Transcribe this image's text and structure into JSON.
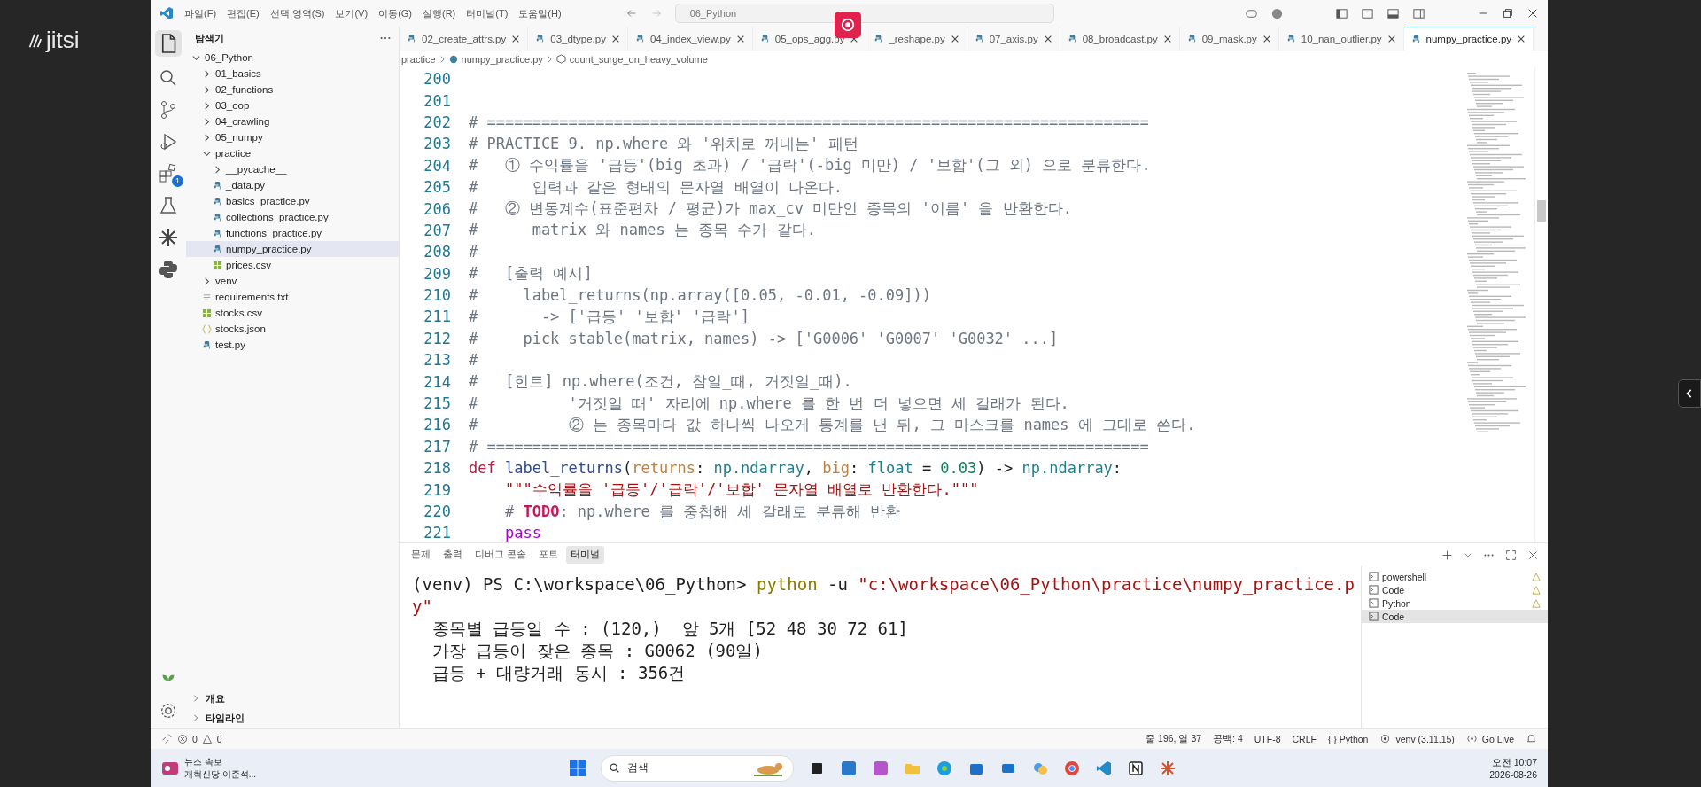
{
  "meeting": {
    "logo": "jitsi"
  },
  "titlebar": {
    "menu": [
      "파일(F)",
      "편집(E)",
      "선택 영역(S)",
      "보기(V)",
      "이동(G)",
      "실행(R)",
      "터미널(T)",
      "도움말(H)"
    ],
    "search": "06_Python"
  },
  "activity_bar": {
    "extensions_badge": "1"
  },
  "explorer": {
    "title": "탐색기",
    "tree": [
      {
        "label": "06_Python",
        "kind": "folder",
        "expanded": true,
        "children": [
          {
            "label": "01_basics",
            "kind": "folder",
            "expanded": false
          },
          {
            "label": "02_functions",
            "kind": "folder",
            "expanded": false
          },
          {
            "label": "03_oop",
            "kind": "folder",
            "expanded": false
          },
          {
            "label": "04_crawling",
            "kind": "folder",
            "expanded": false
          },
          {
            "label": "05_numpy",
            "kind": "folder",
            "expanded": false
          },
          {
            "label": "practice",
            "kind": "folder",
            "expanded": true,
            "children": [
              {
                "label": "__pycache__",
                "kind": "folder",
                "expanded": false
              },
              {
                "label": "_data.py",
                "kind": "python",
                "selected": false
              },
              {
                "label": "basics_practice.py",
                "kind": "python",
                "selected": false
              },
              {
                "label": "collections_practice.py",
                "kind": "python",
                "selected": false
              },
              {
                "label": "functions_practice.py",
                "kind": "python",
                "selected": false
              },
              {
                "label": "numpy_practice.py",
                "kind": "python",
                "selected": true
              },
              {
                "label": "prices.csv",
                "kind": "csv",
                "selected": false
              }
            ]
          },
          {
            "label": "venv",
            "kind": "folder",
            "expanded": false
          },
          {
            "label": "requirements.txt",
            "kind": "text",
            "selected": false
          },
          {
            "label": "stocks.csv",
            "kind": "csv",
            "selected": false
          },
          {
            "label": "stocks.json",
            "kind": "json",
            "selected": false
          },
          {
            "label": "test.py",
            "kind": "python",
            "selected": false
          }
        ]
      }
    ],
    "sections": [
      "개요",
      "타임라인"
    ]
  },
  "tabs": [
    {
      "label": "02_create_attrs.py",
      "selected": false
    },
    {
      "label": "03_dtype.py",
      "selected": false
    },
    {
      "label": "04_index_view.py",
      "selected": false
    },
    {
      "label": "05_ops_agg.py",
      "selected": false
    },
    {
      "label": "_reshape.py",
      "selected": false
    },
    {
      "label": "07_axis.py",
      "selected": false
    },
    {
      "label": "08_broadcast.py",
      "selected": false
    },
    {
      "label": "09_mask.py",
      "selected": false
    },
    {
      "label": "10_nan_outlier.py",
      "selected": false
    },
    {
      "label": "numpy_practice.py",
      "selected": true
    }
  ],
  "breadcrumb": [
    "practice",
    "numpy_practice.py",
    "count_surge_on_heavy_volume"
  ],
  "editor": {
    "lines": [
      {
        "number": "200"
      },
      {
        "number": "201"
      },
      {
        "number": "202",
        "tokens": [
          {
            "kind": "comment",
            "text": "# ========================================================================="
          }
        ]
      },
      {
        "number": "203",
        "tokens": [
          {
            "kind": "comment",
            "text": "# PRACTICE 9. np.where 와 '위치로 꺼내는' 패턴"
          }
        ]
      },
      {
        "number": "204",
        "tokens": [
          {
            "kind": "comment",
            "text": "#   ① 수익률을 '급등'(big 초과) / '급락'(-big 미만) / '보합'(그 외) 으로 분류한다."
          }
        ]
      },
      {
        "number": "205",
        "tokens": [
          {
            "kind": "comment",
            "text": "#      입력과 같은 형태의 문자열 배열이 나온다."
          }
        ]
      },
      {
        "number": "206",
        "tokens": [
          {
            "kind": "comment",
            "text": "#   ② 변동계수(표준편차 / 평균)가 max_cv 미만인 종목의 '이름' 을 반환한다."
          }
        ]
      },
      {
        "number": "207",
        "tokens": [
          {
            "kind": "comment",
            "text": "#      matrix 와 names 는 종목 수가 같다."
          }
        ]
      },
      {
        "number": "208",
        "tokens": [
          {
            "kind": "comment",
            "text": "#"
          }
        ]
      },
      {
        "number": "209",
        "tokens": [
          {
            "kind": "comment",
            "text": "#   [출력 예시]"
          }
        ]
      },
      {
        "number": "210",
        "tokens": [
          {
            "kind": "comment",
            "text": "#     label_returns(np.array([0.05, -0.01, -0.09]))"
          }
        ]
      },
      {
        "number": "211",
        "tokens": [
          {
            "kind": "comment",
            "text": "#       -> ['급등' '보합' '급락']"
          }
        ]
      },
      {
        "number": "212",
        "tokens": [
          {
            "kind": "comment",
            "text": "#     pick_stable(matrix, names) -> ['G0006' 'G0007' 'G0032' ...]"
          }
        ]
      },
      {
        "number": "213",
        "tokens": [
          {
            "kind": "comment",
            "text": "#"
          }
        ]
      },
      {
        "number": "214",
        "tokens": [
          {
            "kind": "comment",
            "text": "#   [힌트] np.where(조건, 참일_때, 거짓일_때)."
          }
        ]
      },
      {
        "number": "215",
        "tokens": [
          {
            "kind": "comment",
            "text": "#          '거짓일 때' 자리에 np.where 를 한 번 더 넣으면 세 갈래가 된다."
          }
        ]
      },
      {
        "number": "216",
        "tokens": [
          {
            "kind": "comment",
            "text": "#          ② 는 종목마다 값 하나씩 나오게 통계를 낸 뒤, 그 마스크를 names 에 그대로 쓴다."
          }
        ]
      },
      {
        "number": "217",
        "tokens": [
          {
            "kind": "comment",
            "text": "# ========================================================================="
          }
        ]
      },
      {
        "number": "218",
        "tokens": [
          {
            "kind": "keyword",
            "text": "def "
          },
          {
            "kind": "function",
            "text": "label_returns"
          },
          {
            "kind": "plain",
            "text": "("
          },
          {
            "kind": "param",
            "text": "returns"
          },
          {
            "kind": "plain",
            "text": ": "
          },
          {
            "kind": "type",
            "text": "np.ndarray"
          },
          {
            "kind": "plain",
            "text": ", "
          },
          {
            "kind": "param",
            "text": "big"
          },
          {
            "kind": "plain",
            "text": ": "
          },
          {
            "kind": "type",
            "text": "float"
          },
          {
            "kind": "plain",
            "text": " = "
          },
          {
            "kind": "number",
            "text": "0.03"
          },
          {
            "kind": "plain",
            "text": ") -> "
          },
          {
            "kind": "type",
            "text": "np.ndarray"
          },
          {
            "kind": "plain",
            "text": ":"
          }
        ]
      },
      {
        "number": "219",
        "tokens": [
          {
            "kind": "string",
            "text": "    \"\"\"수익률을 '급등'/'급락'/'보합' 문자열 배열로 반환한다.\"\"\""
          }
        ]
      },
      {
        "number": "220",
        "tokens": [
          {
            "kind": "comment",
            "text": "    # "
          },
          {
            "kind": "todo",
            "text": "TODO"
          },
          {
            "kind": "comment",
            "text": ": np.where 를 중첩해 세 갈래로 분류해 반환"
          }
        ]
      },
      {
        "number": "221",
        "tokens": [
          {
            "kind": "control",
            "text": "    pass"
          }
        ]
      }
    ]
  },
  "panel": {
    "tabs": [
      {
        "label": "문제",
        "selected": false
      },
      {
        "label": "출력",
        "selected": false
      },
      {
        "label": "디버그 콘솔",
        "selected": false
      },
      {
        "label": "포트",
        "selected": false
      },
      {
        "label": "터미널",
        "selected": true
      }
    ],
    "terminal": {
      "command": [
        {
          "kind": "prompt",
          "text": "(venv) PS C:\\workspace\\06_Python> "
        },
        {
          "kind": "command",
          "text": "python"
        },
        {
          "kind": "plain",
          "text": " -u "
        },
        {
          "kind": "string",
          "text": "\"c:\\workspace\\06_Python\\practice\\numpy_practice.py\""
        }
      ],
      "output": [
        "  종목별 급등일 수 : (120,)  앞 5개 [52 48 30 72 61]",
        "  가장 급등이 잦은 종목 : G0062 (90일)",
        "  급등 + 대량거래 동시 : 356건"
      ]
    },
    "terminals": [
      {
        "label": "powershell",
        "selected": false,
        "warning": true
      },
      {
        "label": "Code",
        "selected": false,
        "warning": true
      },
      {
        "label": "Python",
        "selected": false,
        "warning": true
      },
      {
        "label": "Code",
        "selected": true,
        "warning": false
      }
    ]
  },
  "status_bar": {
    "errors": "0",
    "warnings": "0",
    "items": [
      "줄 196, 열 37",
      "공백: 4",
      "UTF-8",
      "CRLF",
      "{ } Python",
      "venv (3.11.15)",
      "Go Live"
    ]
  },
  "taskbar": {
    "news": {
      "title": "뉴스 속보",
      "headline": "개혁신당 이준석..."
    },
    "search": "검색",
    "clock": {
      "time": "오전 10:07",
      "date": "2026-08-26"
    }
  }
}
